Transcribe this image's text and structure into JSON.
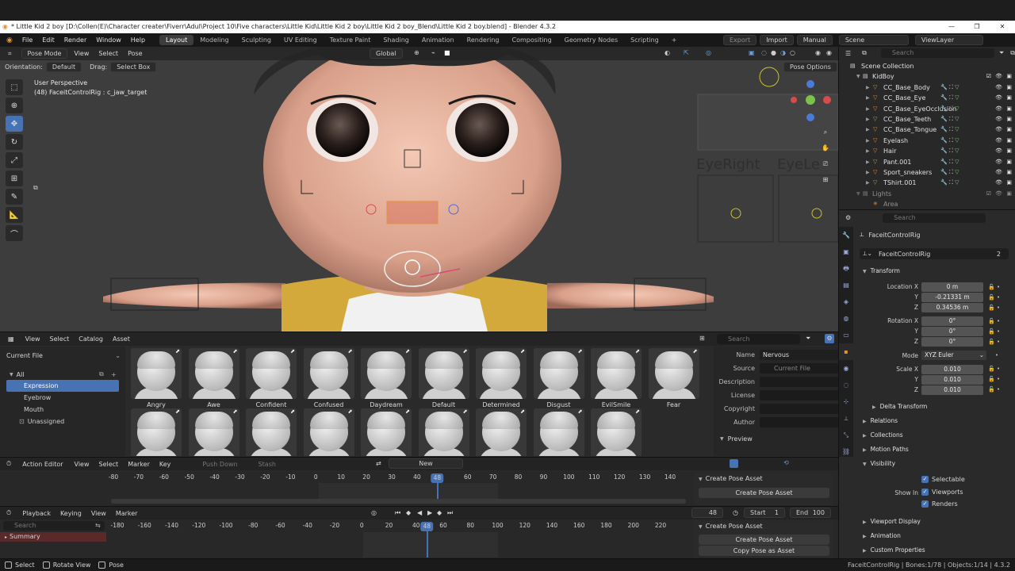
{
  "window": {
    "title": "* Little Kid 2 boy [D:\\Collen(E)\\Character creater\\Fiverr\\Adul\\Project 10\\Five characters\\Little Kid\\Little Kid 2 boy\\Little Kid 2 boy_Blend\\Little Kid 2 boy.blend] - Blender 4.3.2",
    "minimize": "—",
    "maximize": "❐",
    "close": "✕"
  },
  "menu": [
    "File",
    "Edit",
    "Render",
    "Window",
    "Help"
  ],
  "workspaces": [
    "Layout",
    "Modeling",
    "Sculpting",
    "UV Editing",
    "Texture Paint",
    "Shading",
    "Animation",
    "Rendering",
    "Compositing",
    "Geometry Nodes",
    "Scripting",
    "+"
  ],
  "active_workspace": "Layout",
  "topbar_right": {
    "export": "Export",
    "import": "Import",
    "manual": "Manual",
    "scene": "Scene",
    "view_layer": "ViewLayer"
  },
  "viewport": {
    "mode": "Pose Mode",
    "menus": [
      "View",
      "Select",
      "Pose"
    ],
    "orientation_label": "Orientation:",
    "orientation": "Default",
    "drag_label": "Drag:",
    "drag": "Select Box",
    "transform_orientation": "Global",
    "pose_options": "Pose Options",
    "perspective": "User Perspective",
    "active": "(48) FaceitControlRig : c_jaw_target",
    "label_eye_right": "EyeRight",
    "label_eye_left": "EyeLe"
  },
  "asset_browser": {
    "menus": [
      "View",
      "Select",
      "Catalog",
      "Asset"
    ],
    "library": "Current File",
    "search_placeholder": "Search",
    "catalog_root": "All",
    "catalogs": [
      "Expression",
      "Eyebrow",
      "Mouth"
    ],
    "selected_catalog": "Expression",
    "unassigned": "Unassigned",
    "assets_row1": [
      "Angry",
      "Awe",
      "Confident",
      "Confused",
      "Daydream",
      "Default",
      "Determined",
      "Disgust",
      "EvilSmile",
      "Fear"
    ],
    "assets_row2_count": 9,
    "metadata": {
      "name_label": "Name",
      "name": "Nervous",
      "source_label": "Source",
      "source": "Current File",
      "description_label": "Description",
      "license_label": "License",
      "copyright_label": "Copyright",
      "author_label": "Author",
      "preview_label": "Preview"
    }
  },
  "action_editor": {
    "editor": "Action Editor",
    "menus": [
      "View",
      "Select",
      "Marker",
      "Key"
    ],
    "push_down": "Push Down",
    "stash": "Stash",
    "new": "New",
    "ruler": [
      "-80",
      "-70",
      "-60",
      "-50",
      "-40",
      "-30",
      "-20",
      "-10",
      "0",
      "10",
      "20",
      "30",
      "40",
      "48",
      "60",
      "70",
      "80",
      "90",
      "100",
      "110",
      "120",
      "130",
      "140"
    ],
    "current_frame": "48",
    "panel_title": "Create Pose Asset",
    "panel_button": "Create Pose Asset",
    "panel_button2": "Copy Pose as Asset"
  },
  "timeline": {
    "menus": [
      "Playback",
      "Keying",
      "View",
      "Marker"
    ],
    "search_placeholder": "Search",
    "summary": "Summary",
    "current_frame": "48",
    "start_label": "Start",
    "start": "1",
    "end_label": "End",
    "end": "100",
    "ruler": [
      "-180",
      "-160",
      "-140",
      "-120",
      "-100",
      "-80",
      "-60",
      "-40",
      "-20",
      "0",
      "20",
      "40",
      "48",
      "60",
      "80",
      "100",
      "120",
      "140",
      "160",
      "180",
      "200",
      "220"
    ],
    "panel_title": "Create Pose Asset",
    "panel_button": "Create Pose Asset",
    "panel_button2": "Copy Pose as Asset"
  },
  "outliner": {
    "search_placeholder": "Search",
    "scene_collection": "Scene Collection",
    "collection": "KidBoy",
    "items": [
      "CC_Base_Body",
      "CC_Base_Eye",
      "CC_Base_EyeOcclusion",
      "CC_Base_Teeth",
      "CC_Base_Tongue",
      "Eyelash",
      "Hair",
      "Pant.001",
      "Sport_sneakers",
      "TShirt.001"
    ],
    "lights_collection": "Lights",
    "lights_item": "Area"
  },
  "properties": {
    "search_placeholder": "Search",
    "object_name": "FaceitControlRig",
    "data_name": "FaceitControlRig",
    "users": "2",
    "transform": "Transform",
    "location_label": "Location X",
    "location": [
      "0 m",
      "-0.21331 m",
      "0.34536 m"
    ],
    "rotation_label": "Rotation X",
    "rotation": [
      "0°",
      "0°",
      "0°"
    ],
    "mode_label": "Mode",
    "mode": "XYZ Euler",
    "scale_label": "Scale X",
    "scale": [
      "0.010",
      "0.010",
      "0.010"
    ],
    "y_label": "Y",
    "z_label": "Z",
    "delta_transform": "Delta Transform",
    "relations": "Relations",
    "collections": "Collections",
    "motion_paths": "Motion Paths",
    "visibility": "Visibility",
    "selectable": "Selectable",
    "show_in": "Show In",
    "viewports": "Viewports",
    "renders": "Renders",
    "viewport_display": "Viewport Display",
    "animation": "Animation",
    "custom_properties": "Custom Properties"
  },
  "status": {
    "select": "Select",
    "rotate_view": "Rotate View",
    "pose": "Pose",
    "right": "FaceitControlRig | Bones:1/78 | Objects:1/14 | 4.3.2"
  },
  "colors": {
    "accent": "#4772b3",
    "orange": "#e69138",
    "shirt": "#d2a93a"
  }
}
